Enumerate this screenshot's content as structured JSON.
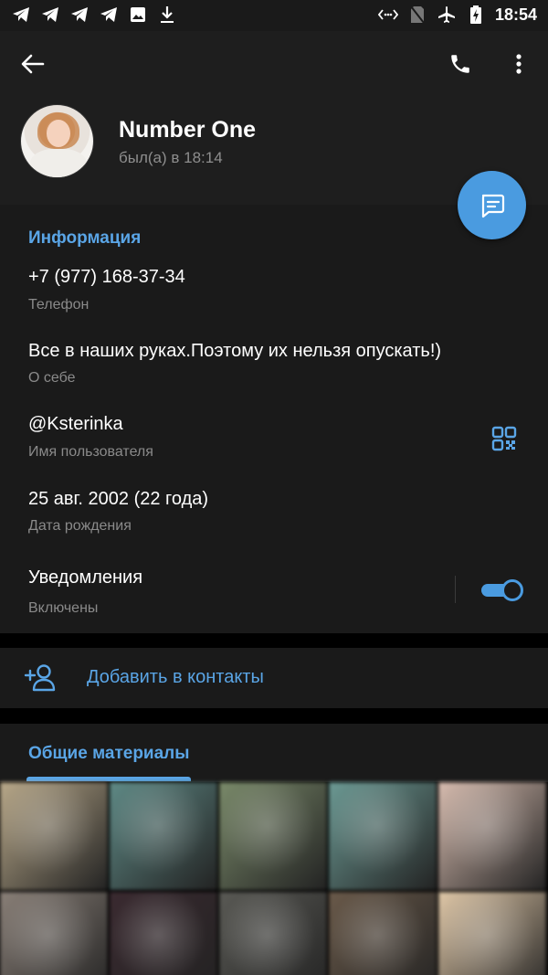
{
  "status_bar": {
    "time": "18:54",
    "left_icons": [
      "telegram-icon",
      "telegram-icon",
      "telegram-icon",
      "telegram-icon",
      "image-icon",
      "download-icon"
    ],
    "right_icons": [
      "wifi-calling-icon",
      "no-sim-icon",
      "airplane-mode-icon",
      "battery-charging-icon"
    ]
  },
  "header": {
    "name": "Number One",
    "status": "был(а) в 18:14"
  },
  "info": {
    "section_title": "Информация",
    "phone": {
      "value": "+7 (977) 168-37-34",
      "label": "Телефон"
    },
    "bio": {
      "value": "Все в наших руках.Поэтому их нельзя опускать!)",
      "label": "О себе"
    },
    "username": {
      "value": "@Ksterinka",
      "label": "Имя пользователя"
    },
    "birthday": {
      "value": "25 авг. 2002 (22 года)",
      "label": "Дата рождения"
    },
    "notifications": {
      "value": "Уведомления",
      "label": "Включены",
      "enabled": true
    }
  },
  "add_contact": {
    "label": "Добавить в контакты"
  },
  "media": {
    "tab": "Общие материалы",
    "thumbnails": [
      "#b9a98a",
      "#5f8a86",
      "#7a8a6a",
      "#6c9a94",
      "#d8bdb0",
      "#8a8078",
      "#3a2a30",
      "#5a5a55",
      "#6a5a4a",
      "#e0c8a8"
    ]
  },
  "colors": {
    "accent": "#4a9be0",
    "accent_text": "#5aa5e6",
    "background": "#1a1a1a"
  }
}
